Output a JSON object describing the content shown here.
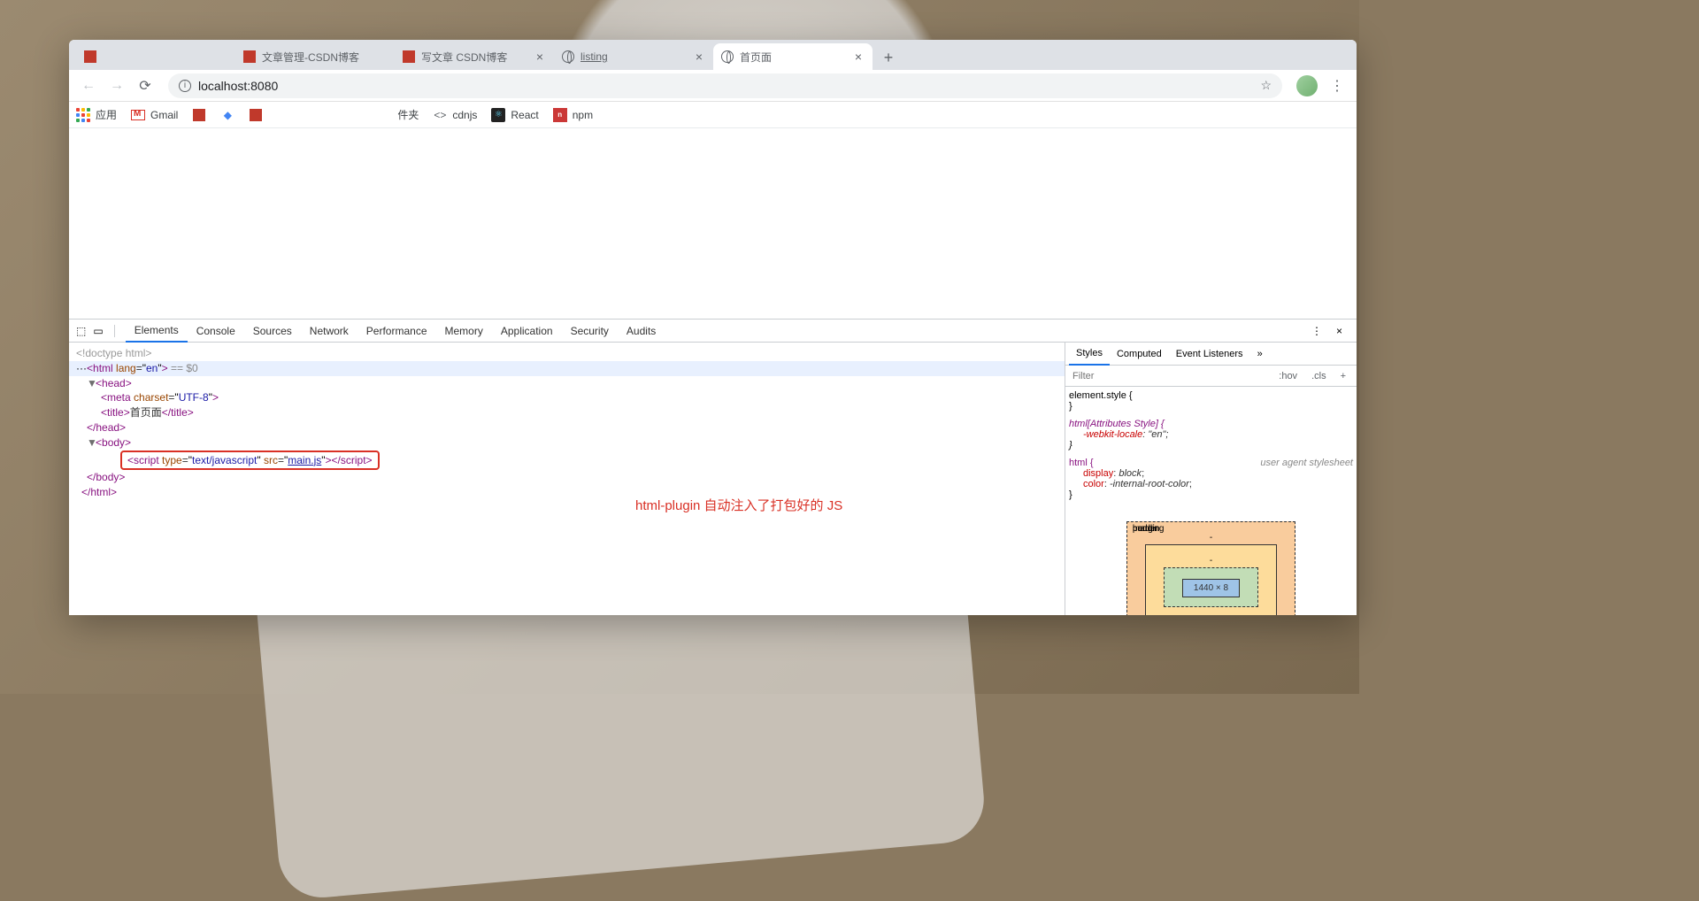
{
  "tabs": [
    {
      "title": "",
      "favicon": "red"
    },
    {
      "title": "文章管理-CSDN博客",
      "favicon": "red"
    },
    {
      "title": "写文章 CSDN博客",
      "favicon": "red",
      "closeable": true
    },
    {
      "title": "listing",
      "favicon": "globe",
      "closeable": true
    },
    {
      "title": "首页面",
      "favicon": "globe",
      "active": true,
      "closeable": true
    }
  ],
  "url": "localhost:8080",
  "new_tab": "+",
  "bookmarks": {
    "apps": "应用",
    "items": [
      "Gmail",
      "",
      "",
      "",
      "",
      "",
      "件夹",
      "cdnjs",
      "React",
      "npm"
    ]
  },
  "devtools": {
    "tabs": [
      "Elements",
      "Console",
      "Sources",
      "Network",
      "Performance",
      "Memory",
      "Application",
      "Security",
      "Audits"
    ],
    "active_tab": "Elements",
    "dom": {
      "doctype": "<!doctype html>",
      "html_open": {
        "tag": "html",
        "attr": "lang",
        "val": "en",
        "suffix": " == $0"
      },
      "head_open": "head",
      "meta": {
        "tag": "meta",
        "attr": "charset",
        "val": "UTF-8"
      },
      "title": {
        "tag": "title",
        "text": "首页面"
      },
      "head_close": "/head",
      "body_open": "body",
      "script": {
        "tag": "script",
        "type_attr": "type",
        "type_val": "text/javascript",
        "src_attr": "src",
        "src_val": "main.js"
      },
      "body_close": "/body",
      "html_close": "/html"
    },
    "annotation": "html-plugin 自动注入了打包好的 JS",
    "styles": {
      "tabs": [
        "Styles",
        "Computed",
        "Event Listeners"
      ],
      "filter_placeholder": "Filter",
      "hov": ":hov",
      "cls": ".cls",
      "plus": "+",
      "rules": {
        "element_style": "element.style {",
        "close": "}",
        "html_attr": "html[Attributes Style] {",
        "webkit_locale": "-webkit-locale",
        "webkit_locale_val": "\"en\"",
        "html_sel": "html {",
        "ua_comment": "user agent stylesheet",
        "display": "display",
        "display_val": "block",
        "color": "color",
        "color_val": "-internal-root-color"
      },
      "box_model": {
        "margin": "margin",
        "border": "border",
        "padding": "padding",
        "content": "1440 × 8",
        "dash": "-"
      }
    }
  }
}
